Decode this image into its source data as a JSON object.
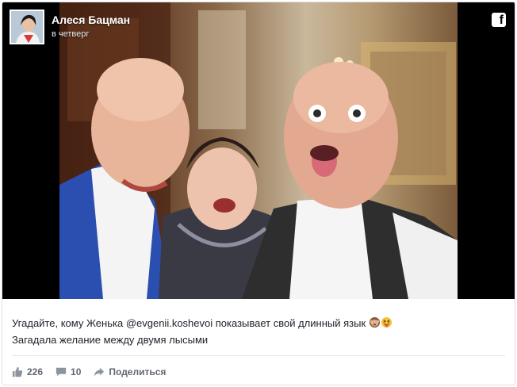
{
  "post": {
    "author_name": "Алеся Бацман",
    "timestamp": "в четверг",
    "network_icon": "facebook-logo-icon",
    "caption_line1_before": "Угадайте, кому Женька ",
    "caption_mention": "@evgenii.koshevoi",
    "caption_line1_after": " показывает свой длинный язык ",
    "caption_emojis": [
      "see-no-evil-monkey-icon",
      "squinting-tongue-face-icon"
    ],
    "caption_line2": "Загадала желание между двумя лысыми"
  },
  "footer": {
    "likes_count": "226",
    "comments_count": "10",
    "share_label": "Поделиться"
  },
  "colors": {
    "text_primary": "#1d2129",
    "text_secondary": "#616770",
    "border": "#dddfe2",
    "photo_background": "#000000"
  }
}
